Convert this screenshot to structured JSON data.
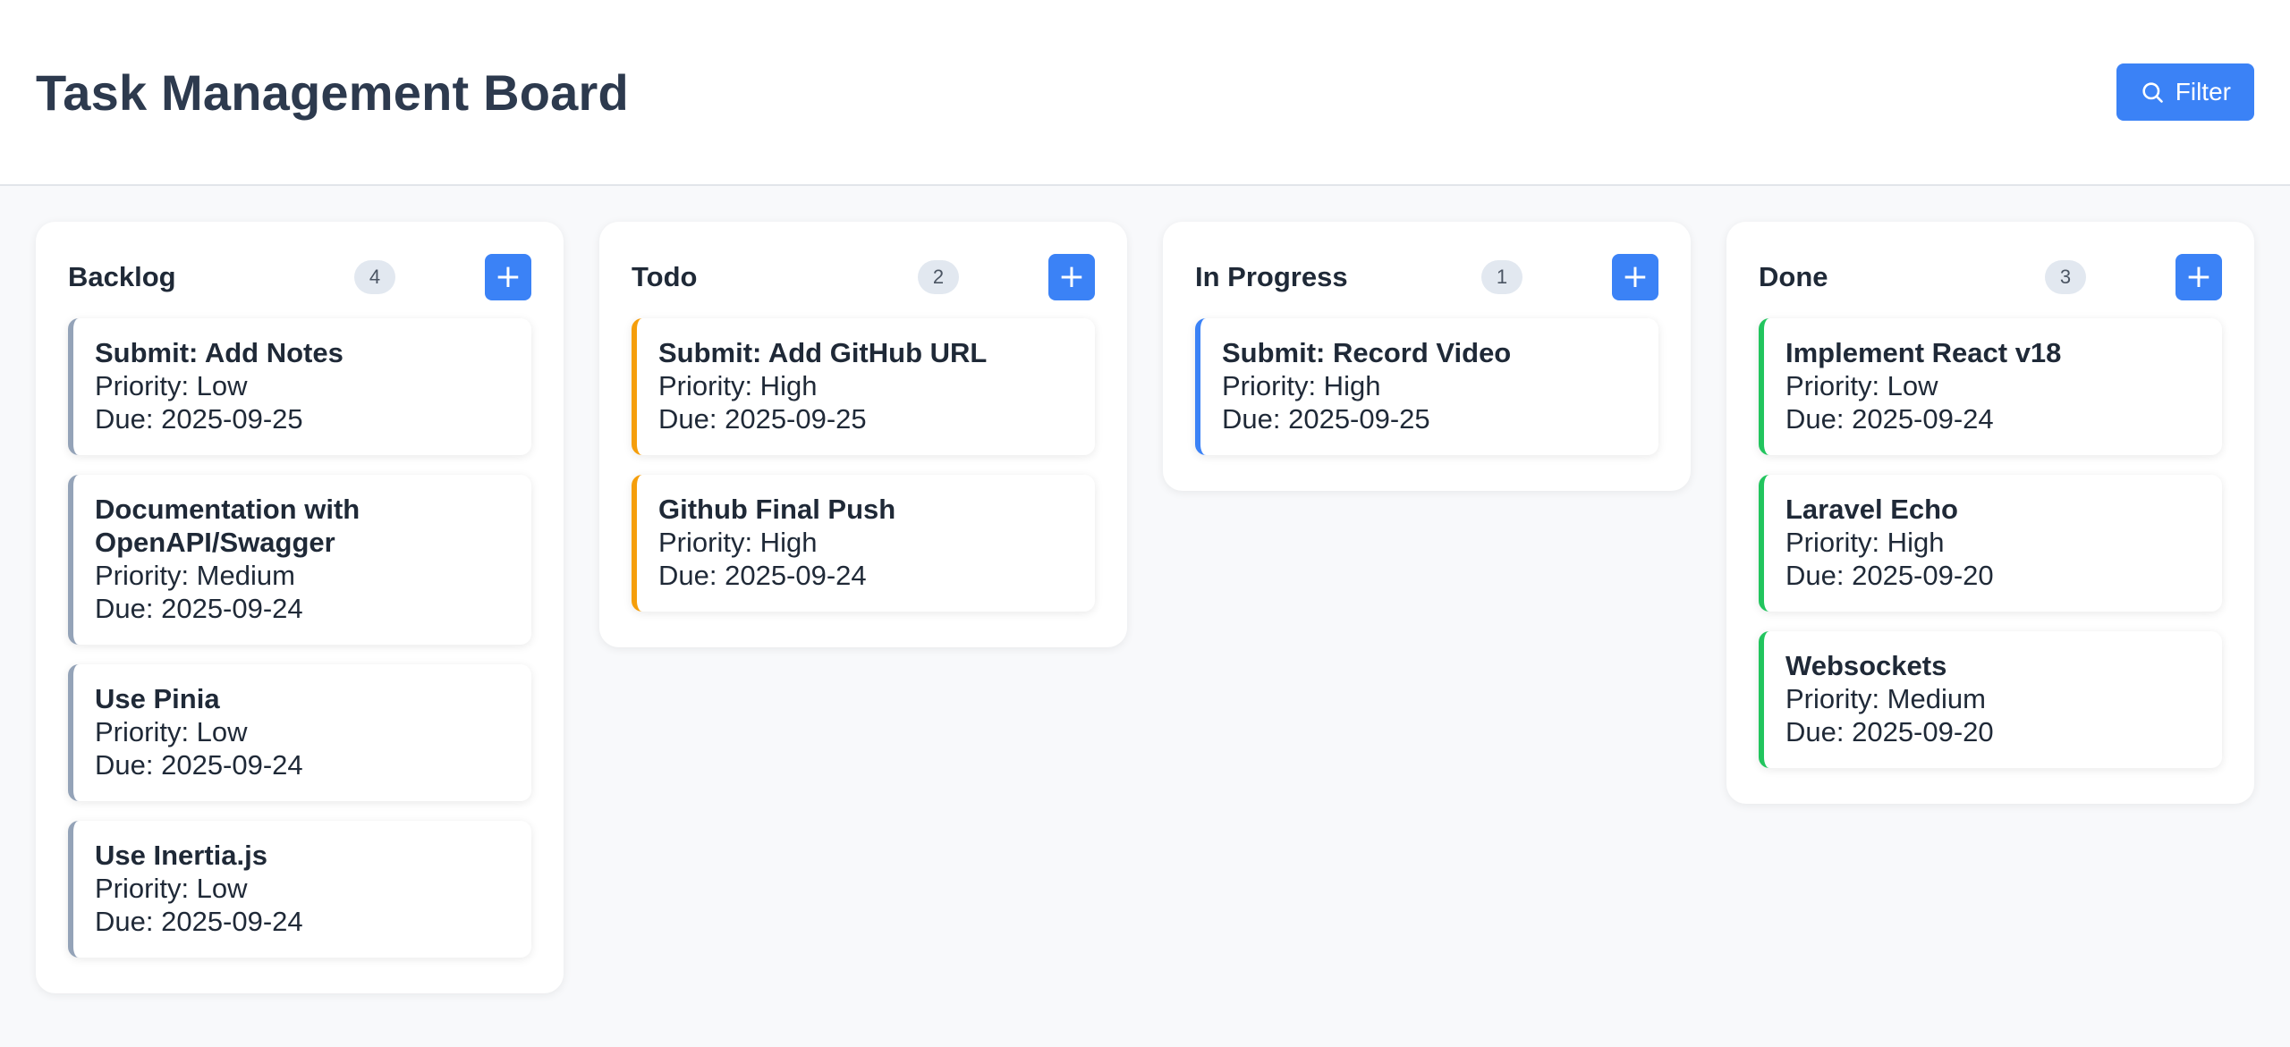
{
  "header": {
    "title": "Task Management Board",
    "filter_label": "Filter",
    "filter_icon": "search-icon"
  },
  "colors": {
    "accent": "#3b82f6",
    "backlog": "#94a3b8",
    "todo": "#f59e0b",
    "in_progress": "#3b82f6",
    "done": "#22c55e"
  },
  "columns": [
    {
      "title": "Backlog",
      "count": "4",
      "add_label": "+",
      "cards": [
        {
          "title": "Submit: Add Notes",
          "priority": "Priority: Low",
          "due": "Due: 2025-09-25"
        },
        {
          "title": "Documentation with OpenAPI/Swagger",
          "priority": "Priority: Medium",
          "due": "Due: 2025-09-24"
        },
        {
          "title": "Use Pinia",
          "priority": "Priority: Low",
          "due": "Due: 2025-09-24"
        },
        {
          "title": "Use Inertia.js",
          "priority": "Priority: Low",
          "due": "Due: 2025-09-24"
        }
      ]
    },
    {
      "title": "Todo",
      "count": "2",
      "add_label": "+",
      "cards": [
        {
          "title": "Submit: Add GitHub URL",
          "priority": "Priority: High",
          "due": "Due: 2025-09-25"
        },
        {
          "title": "Github Final Push",
          "priority": "Priority: High",
          "due": "Due: 2025-09-24"
        }
      ]
    },
    {
      "title": "In Progress",
      "count": "1",
      "add_label": "+",
      "cards": [
        {
          "title": "Submit: Record Video",
          "priority": "Priority: High",
          "due": "Due: 2025-09-25"
        }
      ]
    },
    {
      "title": "Done",
      "count": "3",
      "add_label": "+",
      "cards": [
        {
          "title": "Implement React v18",
          "priority": "Priority: Low",
          "due": "Due: 2025-09-24"
        },
        {
          "title": "Laravel Echo",
          "priority": "Priority: High",
          "due": "Due: 2025-09-20"
        },
        {
          "title": "Websockets",
          "priority": "Priority: Medium",
          "due": "Due: 2025-09-20"
        }
      ]
    }
  ]
}
